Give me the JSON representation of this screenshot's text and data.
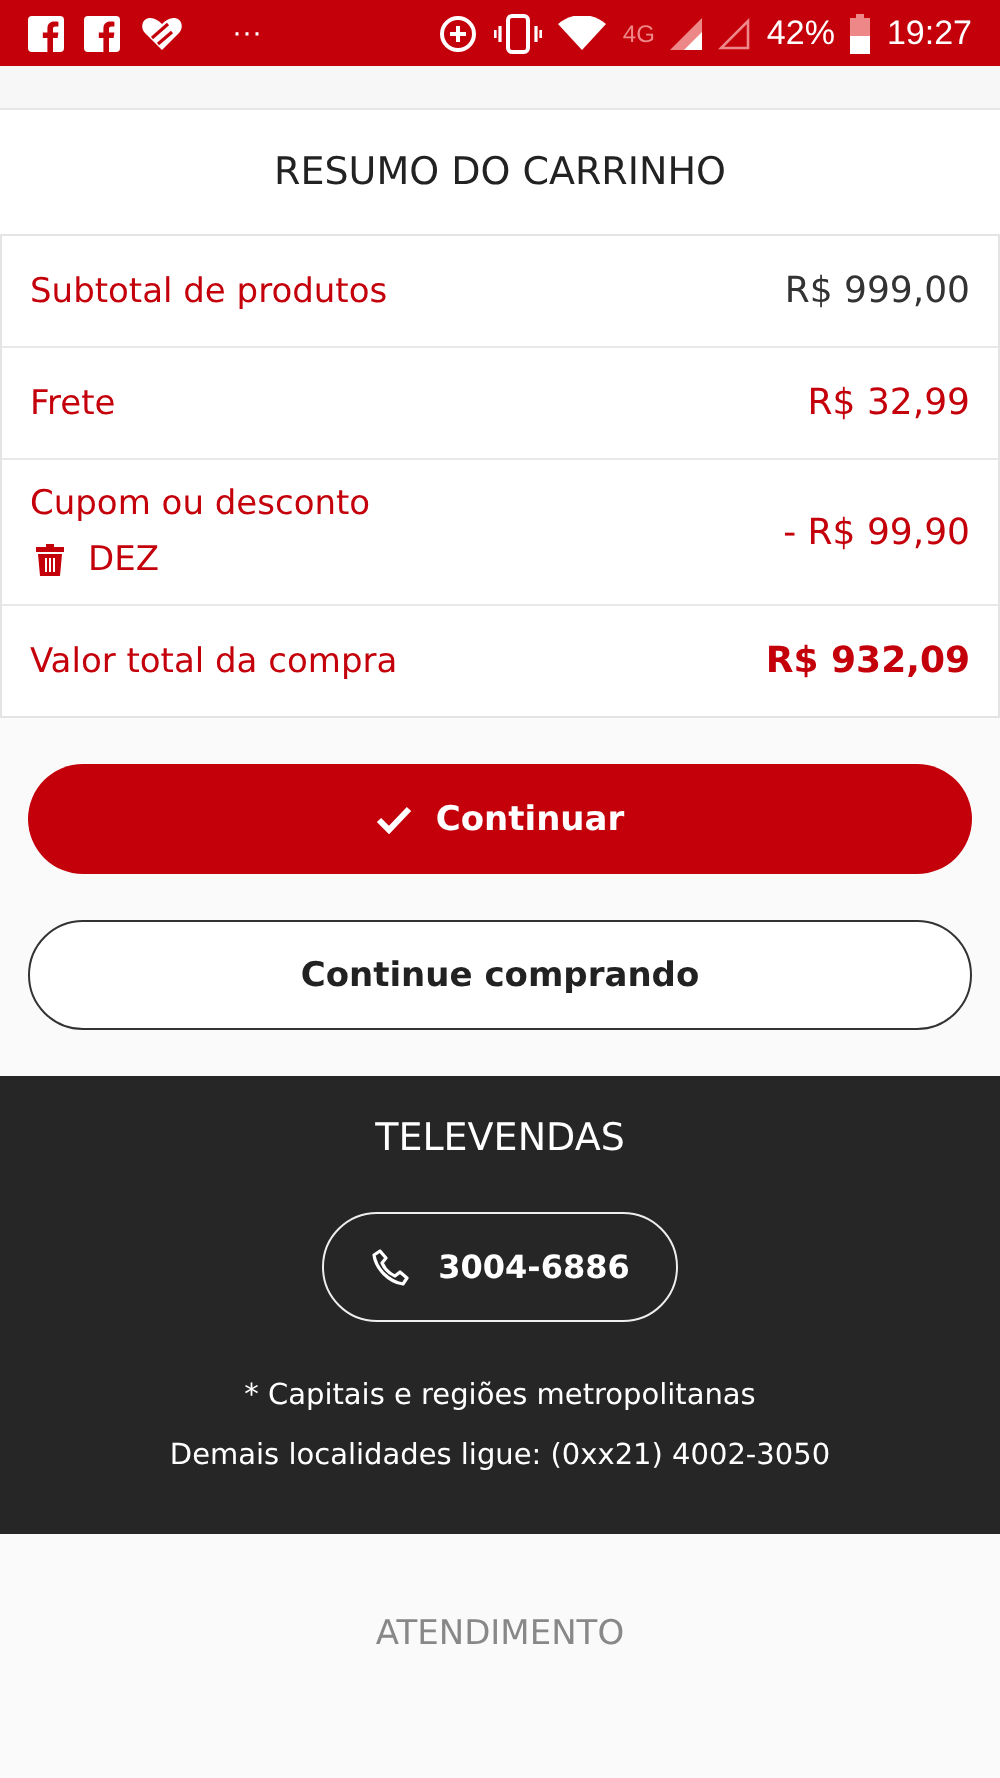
{
  "status_bar": {
    "overflow": "···",
    "network": "4G",
    "battery": "42%",
    "time": "19:27"
  },
  "summary": {
    "title": "RESUMO DO CARRINHO",
    "rows": [
      {
        "kind": "subtotal",
        "label": "Subtotal de produtos",
        "value": "R$ 999,00"
      },
      {
        "kind": "shipping",
        "label": "Frete",
        "value": "R$ 32,99"
      },
      {
        "kind": "coupon",
        "label": "Cupom ou desconto",
        "code": "DEZ",
        "value": "- R$ 99,90"
      },
      {
        "kind": "total",
        "label": "Valor total da compra",
        "value": "R$ 932,09"
      }
    ]
  },
  "buttons": [
    {
      "kind": "primary",
      "label": "Continuar"
    },
    {
      "kind": "outline",
      "label": "Continue comprando"
    }
  ],
  "televendas": {
    "title": "TELEVENDAS",
    "phone": "3004-6886",
    "notes": [
      "* Capitais e regiões metropolitanas",
      "Demais localidades ligue: (0xx21) 4002-3050"
    ]
  },
  "next_section": {
    "title": "ATENDIMENTO"
  }
}
